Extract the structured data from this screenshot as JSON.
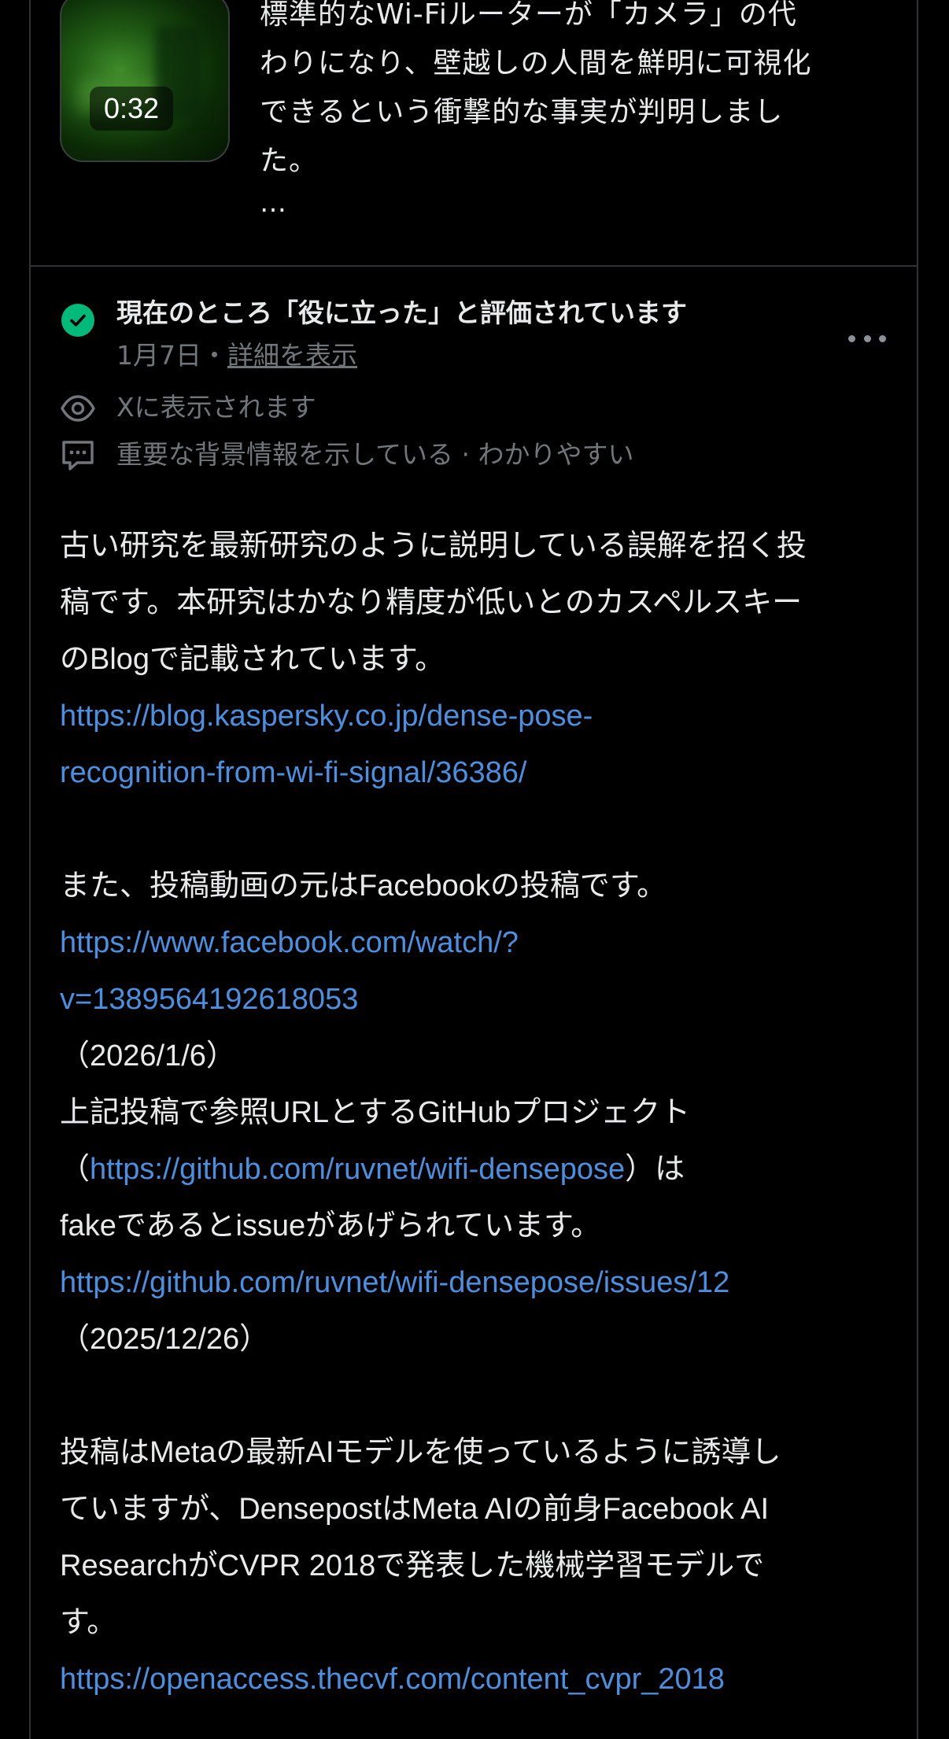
{
  "post": {
    "video_duration": "0:32",
    "text_lines": [
      "標準的なWi-Fiルーターが「カメラ」の代",
      "わりになり、壁越しの人間を鮮明に可視化",
      "できるという衝撃的な事実が判明しまし",
      "た。"
    ],
    "more": "…"
  },
  "note": {
    "status_title": "現在のところ「役に立った」と評価されています",
    "date": "1月7日",
    "separator": "・",
    "detail_link": "詳細を表示",
    "visibility": "Xに表示されます",
    "tags": "重要な背景情報を示している · わかりやすい",
    "body": {
      "l1": "古い研究を最新研究のように説明している誤解を招く投",
      "l2": "稿です。本研究はかなり精度が低いとのカスペルスキー",
      "l3": "のBlogで記載されています。",
      "link1a": "https://blog.kaspersky.co.jp/dense-pose-",
      "link1b": "recognition-from-wi-fi-signal/36386/",
      "l4": "また、投稿動画の元はFacebookの投稿です。",
      "link2a": "https://www.facebook.com/watch/?",
      "link2b": "v=1389564192618053",
      "date1": "（2026/1/6）",
      "l5": "上記投稿で参照URLとするGitHubプロジェクト",
      "l6_open": "（",
      "link3": "https://github.com/ruvnet/wifi-densepose",
      "l6_close": "）は",
      "l7": "fakeであるとissueがあげられています。",
      "link4": "https://github.com/ruvnet/wifi-densepose/issues/12",
      "date2": "（2025/12/26）",
      "l8": "投稿はMetaの最新AIモデルを使っているように誘導し",
      "l9": "ていますが、DensepostはMeta AIの前身Facebook AI",
      "l10": "ResearchがCVPR 2018で発表した機械学習モデルで",
      "l11": "す。",
      "link5": "https://openaccess.thecvf.com/content_cvpr_2018"
    }
  },
  "colors": {
    "background": "#000000",
    "link": "#4a8fe0",
    "helpful_check": "#00ba7c",
    "muted_text": "#71767b",
    "divider": "#2f3336"
  },
  "icons": [
    "play-thumbnail",
    "check-circle-icon",
    "more-dots-icon",
    "eye-icon",
    "comment-icon"
  ]
}
